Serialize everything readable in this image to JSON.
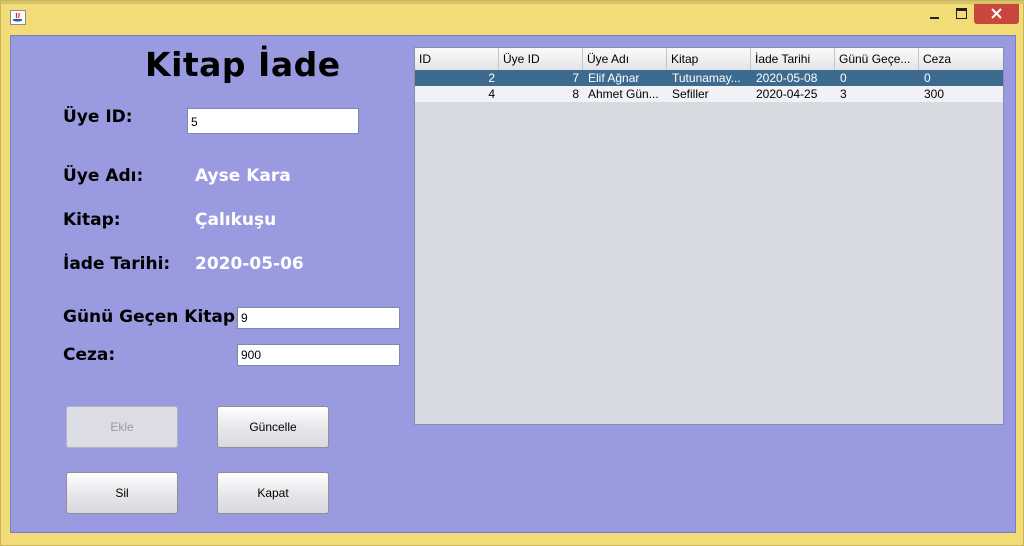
{
  "window": {
    "controls": {
      "minimize": "minimize-icon",
      "maximize": "maximize-icon",
      "close": "close-icon"
    },
    "app_icon": "java-icon"
  },
  "form": {
    "title": "Kitap İade",
    "uye_id_label": "Üye ID:",
    "uye_id_value": "5",
    "uye_adi_label": "Üye Adı:",
    "uye_adi_value": "Ayse Kara",
    "kitap_label": "Kitap:",
    "kitap_value": "Çalıkuşu",
    "iade_tarihi_label": "İade Tarihi:",
    "iade_tarihi_value": "2020-05-06",
    "gunu_gecen_label": "Günü Geçen Kitap:",
    "gunu_gecen_value": "9",
    "ceza_label": "Ceza:",
    "ceza_value": "900"
  },
  "buttons": {
    "ekle": "Ekle",
    "guncelle": "Güncelle",
    "sil": "Sil",
    "kapat": "Kapat"
  },
  "table": {
    "columns": [
      "ID",
      "Üye ID",
      "Üye Adı",
      "Kitap",
      "İade Tarihi",
      "Günü Geçe...",
      "Ceza"
    ],
    "rows": [
      [
        "2",
        "7",
        "Elif Ağnar",
        "Tutunamay...",
        "2020-05-08",
        "0",
        "0"
      ],
      [
        "4",
        "8",
        "Ahmet Gün...",
        "Sefiller",
        "2020-04-25",
        "3",
        "300"
      ]
    ]
  },
  "colors": {
    "panel_bg": "#9a9ae0",
    "frame_bg": "#f1dc78",
    "selected_row": "#3d6b8f",
    "close_button": "#c9463d"
  }
}
